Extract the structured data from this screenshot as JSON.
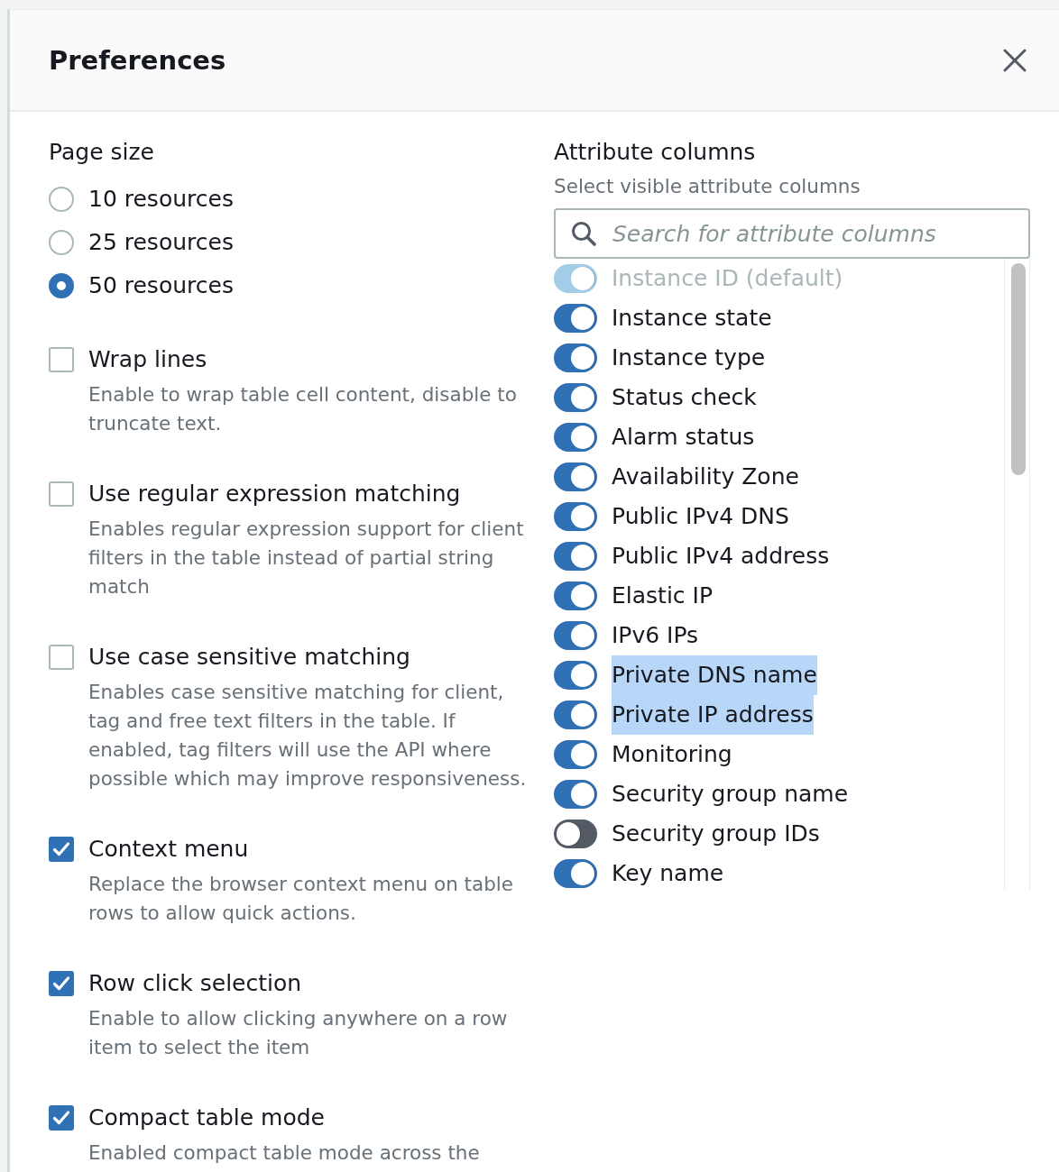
{
  "dialog": {
    "title": "Preferences"
  },
  "page_size": {
    "label": "Page size",
    "options": [
      {
        "label": "10 resources",
        "selected": false
      },
      {
        "label": "25 resources",
        "selected": false
      },
      {
        "label": "50 resources",
        "selected": true
      }
    ]
  },
  "options": [
    {
      "label": "Wrap lines",
      "description": "Enable to wrap table cell content, disable to truncate text.",
      "checked": false
    },
    {
      "label": "Use regular expression matching",
      "description": "Enables regular expression support for client filters in the table instead of partial string match",
      "checked": false
    },
    {
      "label": "Use case sensitive matching",
      "description": "Enables case sensitive matching for client, tag and free text filters in the table. If enabled, tag filters will use the API where possible which may improve responsiveness.",
      "checked": false
    },
    {
      "label": "Context menu",
      "description": "Replace the browser context menu on table rows to allow quick actions.",
      "checked": true
    },
    {
      "label": "Row click selection",
      "description": "Enable to allow clicking anywhere on a row item to select the item",
      "checked": true
    },
    {
      "label": "Compact table mode",
      "description": "Enabled compact table mode across the",
      "checked": true
    }
  ],
  "attribute_columns": {
    "label": "Attribute columns",
    "description": "Select visible attribute columns",
    "search": {
      "placeholder": "Search for attribute columns"
    },
    "items": [
      {
        "label": "Instance ID (default)",
        "on": true,
        "disabled": true,
        "highlighted": false
      },
      {
        "label": "Instance state",
        "on": true,
        "disabled": false,
        "highlighted": false
      },
      {
        "label": "Instance type",
        "on": true,
        "disabled": false,
        "highlighted": false
      },
      {
        "label": "Status check",
        "on": true,
        "disabled": false,
        "highlighted": false
      },
      {
        "label": "Alarm status",
        "on": true,
        "disabled": false,
        "highlighted": false
      },
      {
        "label": "Availability Zone",
        "on": true,
        "disabled": false,
        "highlighted": false
      },
      {
        "label": "Public IPv4 DNS",
        "on": true,
        "disabled": false,
        "highlighted": false
      },
      {
        "label": "Public IPv4 address",
        "on": true,
        "disabled": false,
        "highlighted": false
      },
      {
        "label": "Elastic IP",
        "on": true,
        "disabled": false,
        "highlighted": false
      },
      {
        "label": "IPv6 IPs",
        "on": true,
        "disabled": false,
        "highlighted": false
      },
      {
        "label": "Private DNS name",
        "on": true,
        "disabled": false,
        "highlighted": true
      },
      {
        "label": "Private IP address",
        "on": true,
        "disabled": false,
        "highlighted": true
      },
      {
        "label": "Monitoring",
        "on": true,
        "disabled": false,
        "highlighted": false
      },
      {
        "label": "Security group name",
        "on": true,
        "disabled": false,
        "highlighted": false
      },
      {
        "label": "Security group IDs",
        "on": false,
        "disabled": false,
        "highlighted": false
      },
      {
        "label": "Key name",
        "on": true,
        "disabled": false,
        "highlighted": false
      }
    ]
  }
}
